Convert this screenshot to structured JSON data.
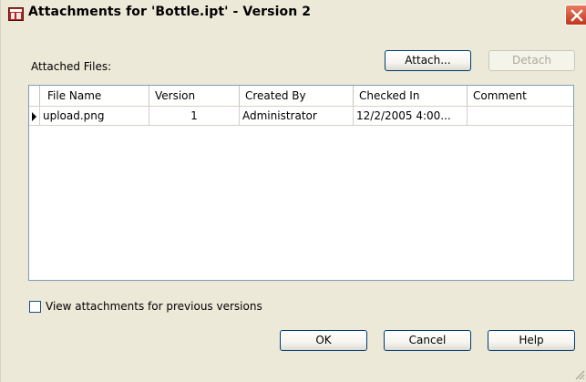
{
  "window": {
    "title": "Attachments for 'Bottle.ipt' - Version 2",
    "close_icon": "close-icon"
  },
  "labels": {
    "attached_files": "Attached Files:"
  },
  "buttons": {
    "attach": "Attach...",
    "detach": "Detach",
    "ok": "OK",
    "cancel": "Cancel",
    "help": "Help"
  },
  "grid": {
    "columns": [
      "File Name",
      "Version",
      "Created By",
      "Checked In",
      "Comment"
    ],
    "rows": [
      {
        "file_name": "upload.png",
        "version": "1",
        "created_by": "Administrator",
        "checked_in": "12/2/2005 4:00...",
        "comment": ""
      }
    ]
  },
  "options": {
    "view_previous_label": "View attachments for previous versions",
    "view_previous_checked": false
  },
  "colors": {
    "dialog_bg": "#ece9d8",
    "grid_border": "#7f9db9",
    "button_border": "#003c74",
    "close_red": "#c2351c"
  }
}
